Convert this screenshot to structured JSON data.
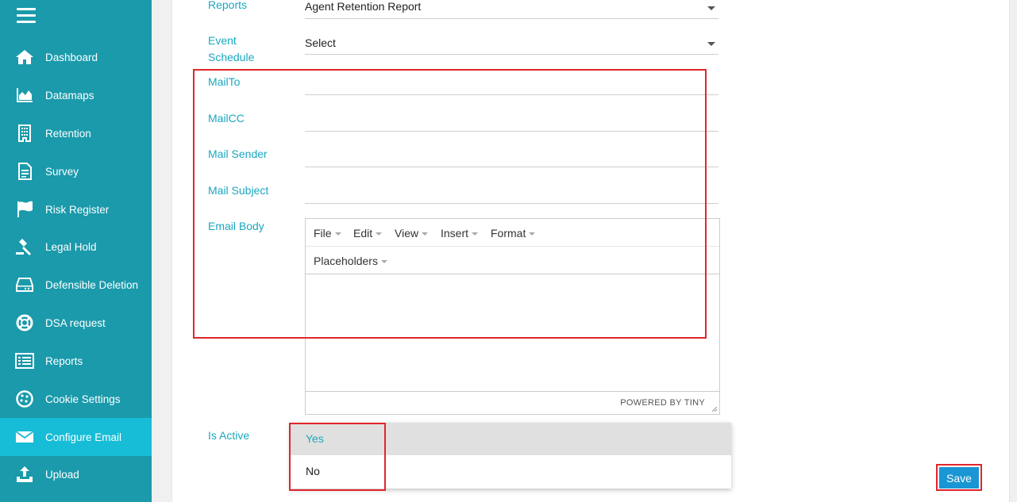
{
  "sidebar": {
    "items": [
      {
        "label": "Dashboard",
        "icon": "home-icon"
      },
      {
        "label": "Datamaps",
        "icon": "area-chart-icon"
      },
      {
        "label": "Retention",
        "icon": "building-icon"
      },
      {
        "label": "Survey",
        "icon": "document-icon"
      },
      {
        "label": "Risk Register",
        "icon": "flag-icon"
      },
      {
        "label": "Legal Hold",
        "icon": "gavel-icon"
      },
      {
        "label": "Defensible Deletion",
        "icon": "hard-drive-icon"
      },
      {
        "label": "DSA request",
        "icon": "life-ring-icon"
      },
      {
        "label": "Reports",
        "icon": "list-icon"
      },
      {
        "label": "Cookie Settings",
        "icon": "cookie-icon"
      },
      {
        "label": "Configure Email",
        "icon": "envelope-icon",
        "active": true
      },
      {
        "label": "Upload",
        "icon": "upload-icon"
      }
    ]
  },
  "form": {
    "reports_label": "Reports",
    "reports_value": "Agent Retention Report",
    "event_schedule_label_1": "Event",
    "event_schedule_label_2": "Schedule",
    "event_schedule_value": "Select",
    "mailto_label": "MailTo",
    "mailcc_label": "MailCC",
    "mail_sender_label": "Mail Sender",
    "mail_subject_label": "Mail Subject",
    "email_body_label": "Email Body",
    "is_active_label": "Is Active"
  },
  "editor": {
    "menus": [
      "File",
      "Edit",
      "View",
      "Insert",
      "Format"
    ],
    "placeholders": "Placeholders",
    "powered_by": "POWERED BY TINY"
  },
  "dropdown": {
    "options": [
      "Yes",
      "No"
    ],
    "selected": "Yes"
  },
  "actions": {
    "save_label": "Save"
  },
  "colors": {
    "sidebar": "#1a9aab",
    "sidebar_active": "#17bcd6",
    "label": "#1ba8bf",
    "save_button": "#1a96d4",
    "highlight": "#e0262b"
  }
}
